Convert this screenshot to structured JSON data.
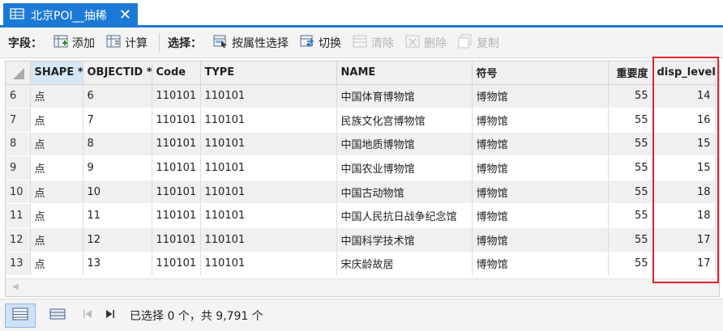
{
  "tab": {
    "title": "北京POI__抽稀",
    "close": "✕"
  },
  "toolbar": {
    "field_label": "字段：",
    "add": "添加",
    "calculate": "计算",
    "selection_label": "选择：",
    "select_by_attributes": "按属性选择",
    "switch": "切换",
    "clear": "清除",
    "delete": "删除",
    "copy": "复制"
  },
  "table": {
    "columns": [
      "SHAPE *",
      "OBJECTID *",
      "Code",
      "TYPE",
      "NAME",
      "符号",
      "重要度",
      "disp_level"
    ],
    "rows": [
      {
        "num": "6",
        "shape": "点",
        "objectid": "6",
        "code": "110101",
        "type": "110101",
        "name": "中国体育博物馆",
        "symbol": "博物馆",
        "importance": "55",
        "disp_level": "14"
      },
      {
        "num": "7",
        "shape": "点",
        "objectid": "7",
        "code": "110101",
        "type": "110101",
        "name": "民族文化宫博物馆",
        "symbol": "博物馆",
        "importance": "55",
        "disp_level": "16"
      },
      {
        "num": "8",
        "shape": "点",
        "objectid": "8",
        "code": "110101",
        "type": "110101",
        "name": "中国地质博物馆",
        "symbol": "博物馆",
        "importance": "55",
        "disp_level": "15"
      },
      {
        "num": "9",
        "shape": "点",
        "objectid": "9",
        "code": "110101",
        "type": "110101",
        "name": "中国农业博物馆",
        "symbol": "博物馆",
        "importance": "55",
        "disp_level": "15"
      },
      {
        "num": "10",
        "shape": "点",
        "objectid": "10",
        "code": "110101",
        "type": "110101",
        "name": "中国古动物馆",
        "symbol": "博物馆",
        "importance": "55",
        "disp_level": "18"
      },
      {
        "num": "11",
        "shape": "点",
        "objectid": "11",
        "code": "110101",
        "type": "110101",
        "name": "中国人民抗日战争纪念馆",
        "symbol": "博物馆",
        "importance": "55",
        "disp_level": "18"
      },
      {
        "num": "12",
        "shape": "点",
        "objectid": "12",
        "code": "110101",
        "type": "110101",
        "name": "中国科学技术馆",
        "symbol": "博物馆",
        "importance": "55",
        "disp_level": "17"
      },
      {
        "num": "13",
        "shape": "点",
        "objectid": "13",
        "code": "110101",
        "type": "110101",
        "name": "宋庆龄故居",
        "symbol": "博物馆",
        "importance": "55",
        "disp_level": "17"
      }
    ]
  },
  "status": {
    "selection_text": "已选择 0 个，共 9,791 个"
  },
  "icons": [
    "table-icon",
    "close-icon",
    "add-field-icon",
    "calculate-icon",
    "select-by-attributes-icon",
    "switch-icon",
    "clear-icon",
    "delete-icon",
    "copy-icon",
    "table-view-icon",
    "list-view-icon",
    "first-record-icon",
    "last-record-icon"
  ],
  "colors": {
    "accent": "#1c7ad6",
    "highlight": "#e0232b"
  }
}
